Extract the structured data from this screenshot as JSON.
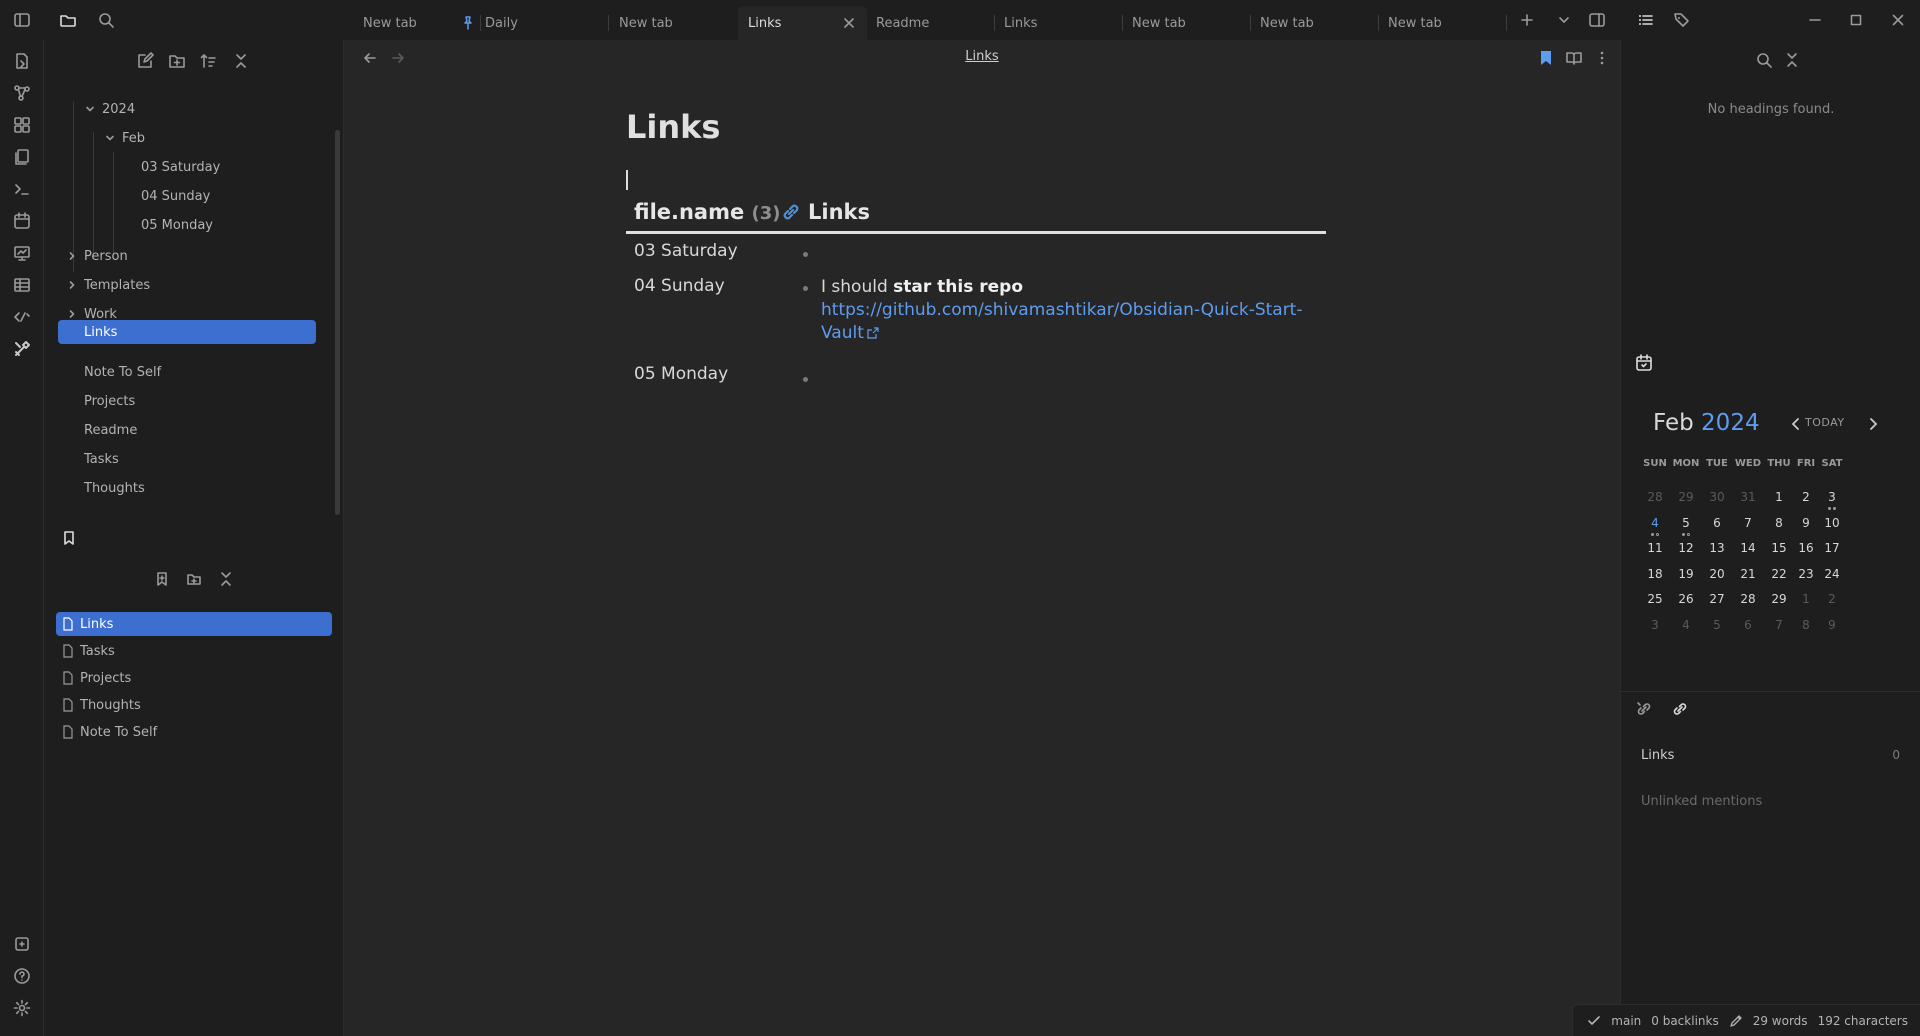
{
  "tabs": [
    {
      "label": "New tab",
      "pinned": false,
      "active": false
    },
    {
      "label": "Daily",
      "pinned": true,
      "active": false
    },
    {
      "label": "New tab",
      "pinned": false,
      "active": false
    },
    {
      "label": "Links",
      "pinned": false,
      "active": true
    },
    {
      "label": "Readme",
      "pinned": false,
      "active": false
    },
    {
      "label": "Links",
      "pinned": false,
      "active": false
    },
    {
      "label": "New tab",
      "pinned": false,
      "active": false
    },
    {
      "label": "New tab",
      "pinned": false,
      "active": false
    },
    {
      "label": "New tab",
      "pinned": false,
      "active": false
    }
  ],
  "file_tree": {
    "items": [
      {
        "label": "2024",
        "expanded": true
      },
      {
        "label": "Feb",
        "expanded": true
      },
      {
        "label": "03 Saturday"
      },
      {
        "label": "04 Sunday"
      },
      {
        "label": "05 Monday"
      },
      {
        "label": "Person",
        "expanded": false
      },
      {
        "label": "Templates",
        "expanded": false
      },
      {
        "label": "Work",
        "expanded": false
      },
      {
        "label": "Links",
        "selected": true
      },
      {
        "label": "Note To Self"
      },
      {
        "label": "Projects"
      },
      {
        "label": "Readme"
      },
      {
        "label": "Tasks"
      },
      {
        "label": "Thoughts"
      }
    ]
  },
  "bookmarks": {
    "items": [
      {
        "label": "Links",
        "selected": true
      },
      {
        "label": "Tasks"
      },
      {
        "label": "Projects"
      },
      {
        "label": "Thoughts"
      },
      {
        "label": "Note To Self"
      }
    ]
  },
  "view": {
    "title": "Links"
  },
  "note": {
    "title": "Links"
  },
  "dataview": {
    "col1_label": "file.name",
    "col1_count": "(3)",
    "col2_label": "Links",
    "rows": [
      {
        "name": "03 Saturday",
        "text_prefix": "",
        "bold": "",
        "url": ""
      },
      {
        "name": "04 Sunday",
        "text_prefix": "I should ",
        "bold": "star this repo",
        "url": "https://github.com/shivamashtikar/Obsidian-Quick-Start-Vault"
      },
      {
        "name": "05 Monday",
        "text_prefix": "",
        "bold": "",
        "url": ""
      }
    ]
  },
  "outline": {
    "empty_text": "No headings found."
  },
  "calendar": {
    "month": "Feb",
    "year": "2024",
    "today_label": "TODAY",
    "weekdays": [
      "SUN",
      "MON",
      "TUE",
      "WED",
      "THU",
      "FRI",
      "SAT"
    ],
    "weeks": [
      [
        {
          "d": "28",
          "adj": true
        },
        {
          "d": "29",
          "adj": true
        },
        {
          "d": "30",
          "adj": true
        },
        {
          "d": "31",
          "adj": true
        },
        {
          "d": "1"
        },
        {
          "d": "2"
        },
        {
          "d": "3",
          "dots": [
            "filled",
            "filled"
          ]
        }
      ],
      [
        {
          "d": "4",
          "today": true,
          "dots": [
            "filled",
            "hollow"
          ]
        },
        {
          "d": "5",
          "dots": [
            "filled",
            "hollow"
          ]
        },
        {
          "d": "6"
        },
        {
          "d": "7"
        },
        {
          "d": "8"
        },
        {
          "d": "9"
        },
        {
          "d": "10"
        }
      ],
      [
        {
          "d": "11"
        },
        {
          "d": "12"
        },
        {
          "d": "13"
        },
        {
          "d": "14"
        },
        {
          "d": "15"
        },
        {
          "d": "16"
        },
        {
          "d": "17"
        }
      ],
      [
        {
          "d": "18"
        },
        {
          "d": "19"
        },
        {
          "d": "20"
        },
        {
          "d": "21"
        },
        {
          "d": "22"
        },
        {
          "d": "23"
        },
        {
          "d": "24"
        }
      ],
      [
        {
          "d": "25"
        },
        {
          "d": "26"
        },
        {
          "d": "27"
        },
        {
          "d": "28"
        },
        {
          "d": "29"
        },
        {
          "d": "1",
          "adj": true
        },
        {
          "d": "2",
          "adj": true
        }
      ],
      [
        {
          "d": "3",
          "adj": true
        },
        {
          "d": "4",
          "adj": true
        },
        {
          "d": "5",
          "adj": true
        },
        {
          "d": "6",
          "adj": true
        },
        {
          "d": "7",
          "adj": true
        },
        {
          "d": "8",
          "adj": true
        },
        {
          "d": "9",
          "adj": true
        }
      ]
    ]
  },
  "backlinks": {
    "title": "Links",
    "count": "0",
    "unlinked_label": "Unlinked mentions"
  },
  "statusbar": {
    "branch": "main",
    "backlinks": "0 backlinks",
    "words": "29 words",
    "characters": "192 characters"
  },
  "colors": {
    "accent": "#3d6fd1",
    "link": "#5e9cf0",
    "background": "#262626",
    "sidebar": "#1e1e1e"
  }
}
